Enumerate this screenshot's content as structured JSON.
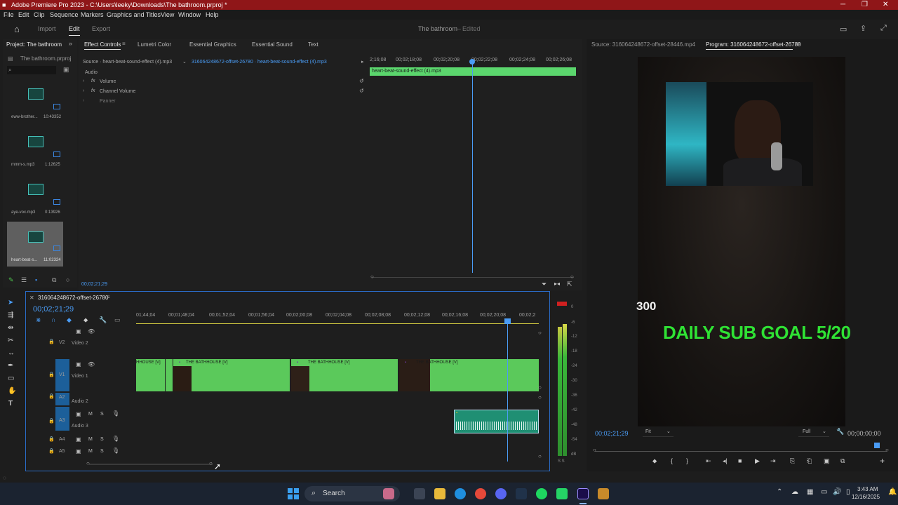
{
  "window": {
    "title": "Adobe Premiere Pro 2023 - C:\\Users\\leeky\\Downloads\\The bathroom.prproj *",
    "menu": [
      "File",
      "Edit",
      "Clip",
      "Sequence",
      "Markers",
      "Graphics and Titles",
      "View",
      "Window",
      "Help"
    ]
  },
  "header": {
    "tabs": [
      "Import",
      "Edit",
      "Export"
    ],
    "project_name": "The bathroom",
    "project_status": "Edited"
  },
  "project_panel": {
    "tab": "Project: The bathroom",
    "file": "The bathroom.prproj",
    "items": [
      {
        "name": "eww-brother...",
        "duration": "10:43352"
      },
      {
        "name": "mmm-s.mp3",
        "duration": "1:12625"
      },
      {
        "name": "aye-vox.mp3",
        "duration": "0:13926"
      },
      {
        "name": "heart-beat-s...",
        "duration": "11:02324"
      }
    ]
  },
  "effect_controls": {
    "tabs": [
      "Effect Controls",
      "Lumetri Color",
      "Essential Graphics",
      "Essential Sound",
      "Text"
    ],
    "source": "Source · heart-beat-sound-effect (4).mp3",
    "sequence_clip": "316064248672-offset-26780 · heart-beat-sound-effect (4).mp3",
    "section": "Audio",
    "effects": [
      "Volume",
      "Channel Volume",
      "Panner"
    ],
    "ruler": [
      "2;16;08",
      "00;02;18;08",
      "00;02;20;08",
      "00;02;22;08",
      "00;02;24;08",
      "00;02;26;08"
    ],
    "clip_name": "heart-beat-sound-effect (4).mp3",
    "timecode": "00;02;21;29"
  },
  "program_monitor": {
    "source_tab": "Source: 316064248672-offset-28446.mp4",
    "program_tab": "Program: 316064248672-offset-26780",
    "overlay_text": "DAILY SUB GOAL 5/20",
    "side_text": "300",
    "timecode": "00;02;21;29",
    "fit": "Fit",
    "quality": "Full",
    "duration": "00;00;00;00"
  },
  "timeline": {
    "sequence": "316064248672-offset-26780",
    "timecode": "00;02;21;29",
    "ruler": [
      "01;44;04",
      "00;01;48;04",
      "00;01;52;04",
      "00;01;56;04",
      "00;02;00;08",
      "00;02;04;08",
      "00;02;08;08",
      "00;02;12;08",
      "00;02;16;08",
      "00;02;20;08",
      "00;02;2"
    ],
    "tracks": {
      "v2": "V2",
      "v2_name": "Video 2",
      "v1": "V1",
      "v1_name": "Video 1",
      "a2": "A2",
      "a2_name": "Audio 2",
      "a3": "A3",
      "a3_name": "Audio 3",
      "a4": "A4",
      "a5": "A5"
    },
    "clips": [
      "HHOUSE [V]",
      "THE BATHHOUSE [V]",
      "THE BATHHOUSE [V]",
      "THE BATHHOUSE [V]"
    ],
    "ms": "M",
    "s": "S"
  },
  "meter": {
    "labels": [
      "0",
      "-6",
      "-12",
      "-18",
      "-24",
      "-30",
      "-36",
      "-42",
      "-48",
      "-54",
      "dB"
    ],
    "footer": "S S"
  },
  "taskbar": {
    "search": "Search",
    "time": "3:43 AM",
    "date": "12/16/2025"
  },
  "colors": {
    "title_bar": "#8f1618",
    "clip_green": "#5bc95b",
    "audio_clip": "#1f8f73",
    "accent_blue": "#2a6bc6",
    "overlay_green": "#2fe234"
  }
}
